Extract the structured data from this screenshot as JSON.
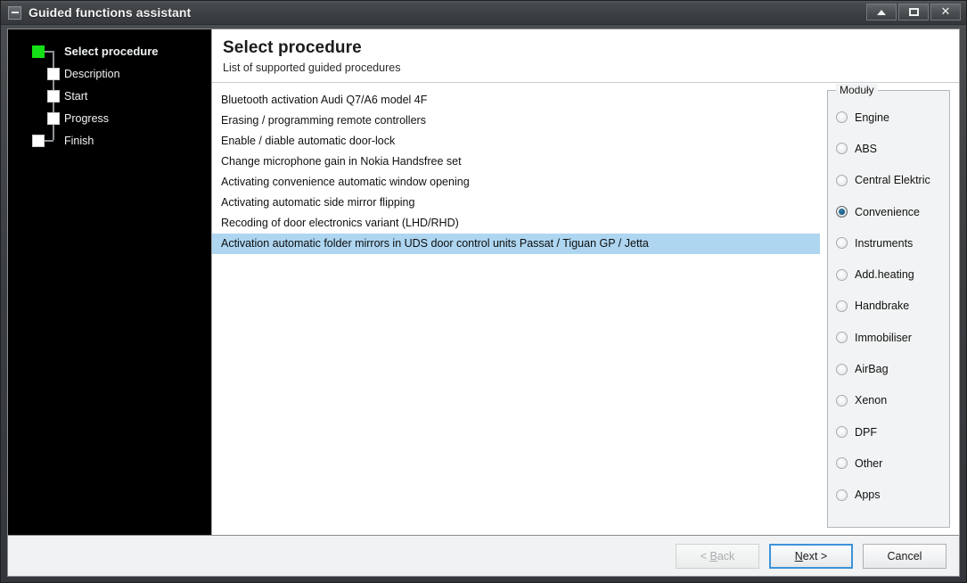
{
  "window": {
    "title": "Guided functions assistant",
    "icon": "window-minimize-icon",
    "caption_buttons": [
      {
        "name": "minimize-button",
        "glyph": "triangle-up"
      },
      {
        "name": "maximize-button",
        "glyph": "square"
      },
      {
        "name": "close-button",
        "glyph": "X"
      }
    ]
  },
  "steps": [
    {
      "label": "Select procedure",
      "state": "current",
      "level": 0
    },
    {
      "label": "Description",
      "state": "pending",
      "level": 1
    },
    {
      "label": "Start",
      "state": "pending",
      "level": 1
    },
    {
      "label": "Progress",
      "state": "pending",
      "level": 1
    },
    {
      "label": "Finish",
      "state": "pending",
      "level": 0
    }
  ],
  "main": {
    "title": "Select procedure",
    "subtitle": "List of supported guided procedures",
    "procedures": [
      {
        "label": "Bluetooth activation Audi Q7/A6 model 4F",
        "selected": false
      },
      {
        "label": "Erasing / programming remote controllers",
        "selected": false
      },
      {
        "label": "Enable / diable automatic door-lock",
        "selected": false
      },
      {
        "label": "Change microphone gain in Nokia Handsfree set",
        "selected": false
      },
      {
        "label": "Activating convenience automatic window opening",
        "selected": false
      },
      {
        "label": "Activating automatic side mirror flipping",
        "selected": false
      },
      {
        "label": "Recoding of door electronics variant (LHD/RHD)",
        "selected": false
      },
      {
        "label": "Activation automatic folder mirrors in UDS door control units Passat / Tiguan GP / Jetta",
        "selected": true
      }
    ]
  },
  "modules": {
    "title": "Moduły",
    "options": [
      {
        "label": "Engine",
        "checked": false
      },
      {
        "label": "ABS",
        "checked": false
      },
      {
        "label": "Central Elektric",
        "checked": false
      },
      {
        "label": "Convenience",
        "checked": true
      },
      {
        "label": "Instruments",
        "checked": false
      },
      {
        "label": "Add.heating",
        "checked": false
      },
      {
        "label": "Handbrake",
        "checked": false
      },
      {
        "label": "Immobiliser",
        "checked": false
      },
      {
        "label": "AirBag",
        "checked": false
      },
      {
        "label": "Xenon",
        "checked": false
      },
      {
        "label": "DPF",
        "checked": false
      },
      {
        "label": "Other",
        "checked": false
      },
      {
        "label": "Apps",
        "checked": false
      }
    ]
  },
  "footer": {
    "back_label": "< Back",
    "next_label": "Next >",
    "cancel_label": "Cancel",
    "back_enabled": false,
    "next_focused": true
  },
  "colors": {
    "selection": "#aed6f1",
    "step_current": "#15e015",
    "radio_checked": "#1b5e86",
    "focus_border": "#3c93d8",
    "titlebar": "#3c4043"
  }
}
